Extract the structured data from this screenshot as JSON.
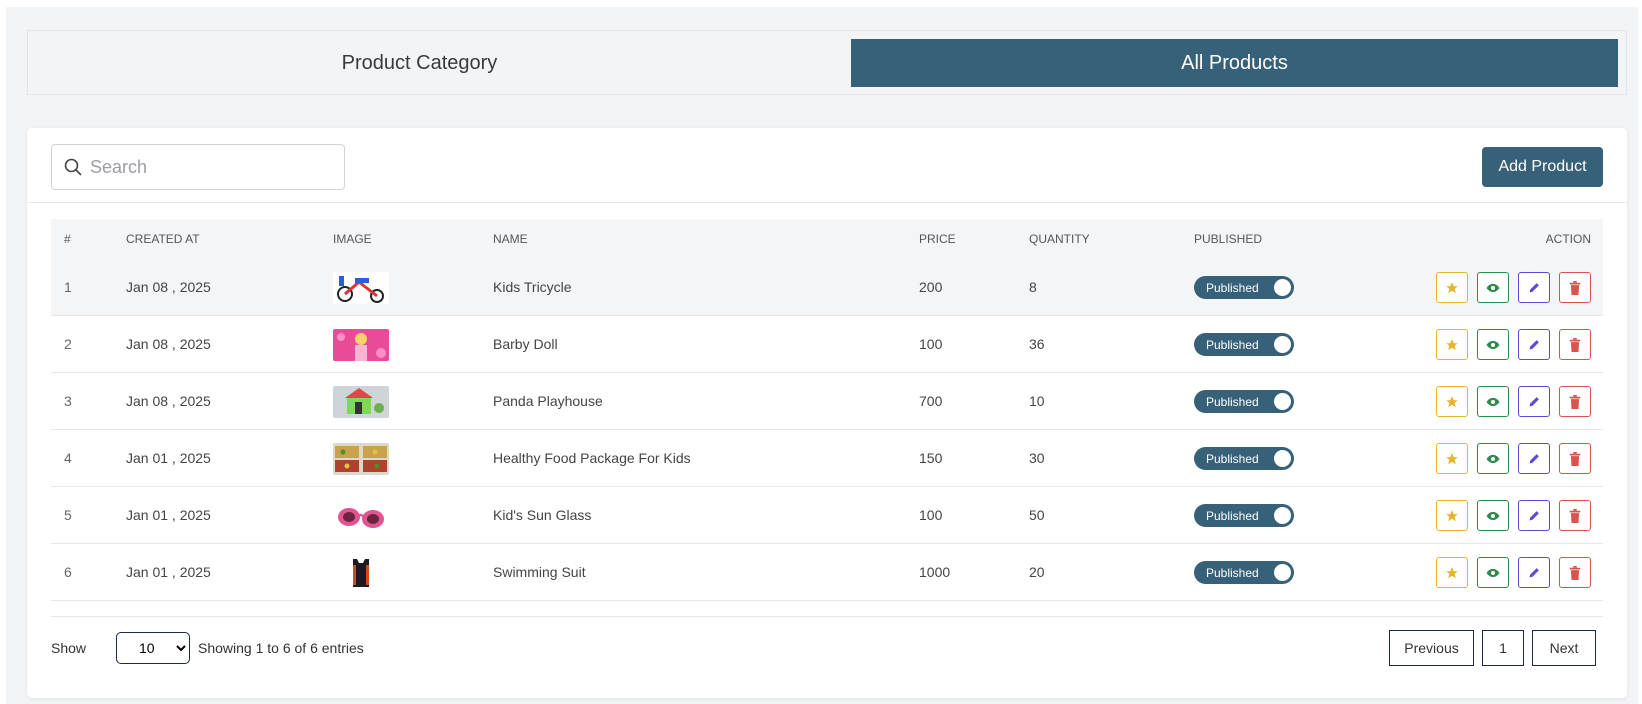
{
  "tabs": [
    {
      "label": "Product Category",
      "active": false
    },
    {
      "label": "All Products",
      "active": true
    }
  ],
  "search": {
    "placeholder": "Search"
  },
  "add_product_label": "Add Product",
  "colors": {
    "primary": "#376079",
    "star": "#e5b52b",
    "view": "#2e8b4a",
    "edit": "#5a4ad6",
    "delete": "#d9534f"
  },
  "columns": [
    "#",
    "CREATED AT",
    "IMAGE",
    "NAME",
    "PRICE",
    "QUANTITY",
    "PUBLISHED",
    "ACTION"
  ],
  "rows": [
    {
      "num": "1",
      "created": "Jan 08 , 2025",
      "name": "Kids Tricycle",
      "price": "200",
      "quantity": "8",
      "status": "Published"
    },
    {
      "num": "2",
      "created": "Jan 08 , 2025",
      "name": "Barby Doll",
      "price": "100",
      "quantity": "36",
      "status": "Published"
    },
    {
      "num": "3",
      "created": "Jan 08 , 2025",
      "name": "Panda Playhouse",
      "price": "700",
      "quantity": "10",
      "status": "Published"
    },
    {
      "num": "4",
      "created": "Jan 01 , 2025",
      "name": "Healthy Food Package For Kids",
      "price": "150",
      "quantity": "30",
      "status": "Published"
    },
    {
      "num": "5",
      "created": "Jan 01 , 2025",
      "name": "Kid's Sun Glass",
      "price": "100",
      "quantity": "50",
      "status": "Published"
    },
    {
      "num": "6",
      "created": "Jan 01 , 2025",
      "name": "Swimming Suit",
      "price": "1000",
      "quantity": "20",
      "status": "Published"
    }
  ],
  "action_icons": [
    "star-icon",
    "eye-icon",
    "pencil-icon",
    "trash-icon"
  ],
  "footer": {
    "show_label": "Show",
    "page_size": "10",
    "showing_text": "Showing 1 to 6 of 6 entries",
    "previous_label": "Previous",
    "current_page": "1",
    "next_label": "Next"
  }
}
